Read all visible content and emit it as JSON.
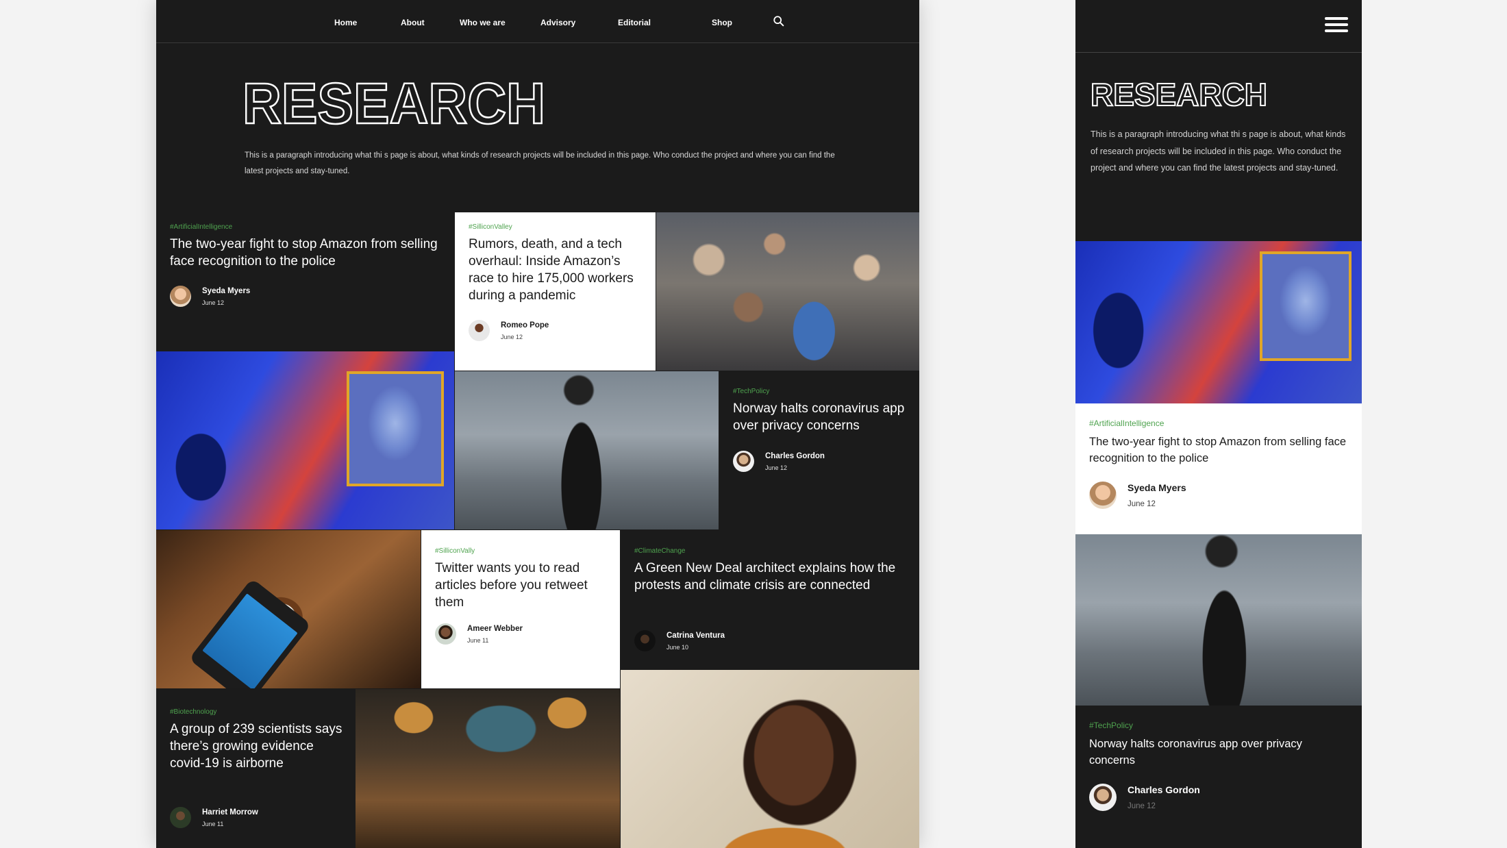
{
  "nav": {
    "items": [
      "Home",
      "About",
      "Who we are",
      "Advisory",
      "Editorial",
      "Shop"
    ],
    "search_icon": "search-icon"
  },
  "hero": {
    "title": "RESEARCH",
    "paragraph": "This is a paragraph introducing what thi s page is about, what kinds of research projects will be included in this page. Who conduct the project and where you can find the latest projects and stay-tuned."
  },
  "articles": [
    {
      "tag": "#ArtificialIntelligence",
      "title": "The two-year fight to stop Amazon from selling face recognition to the police",
      "author": "Syeda Myers",
      "date": "June 12"
    },
    {
      "tag": "#SilliconValley",
      "title": "Rumors, death, and a tech overhaul: Inside Amazon’s race to hire 175,000 workers during a pandemic",
      "author": "Romeo Pope",
      "date": "June 12"
    },
    {
      "tag": "#TechPolicy",
      "title": "Norway halts coronavirus app over privacy concerns",
      "author": "Charles Gordon",
      "date": "June 12"
    },
    {
      "tag": "#SilliconVally",
      "title": "Twitter wants you to read articles before you retweet them",
      "author": "Ameer Webber",
      "date": "June 11"
    },
    {
      "tag": "#ClimateChange",
      "title": "A Green New Deal architect explains how the protests and climate crisis are connected",
      "author": "Catrina Ventura",
      "date": "June 10"
    },
    {
      "tag": "#Biotechnology",
      "title": "A group of 239 scientists says there’s growing evidence covid-19 is airborne",
      "author": "Harriet Morrow",
      "date": "June 11"
    }
  ],
  "mobile": {
    "menu_icon": "hamburger-menu-icon",
    "title": "RESEARCH",
    "paragraph": "This is a paragraph introducing what thi s page is about, what kinds of research projects will be included in this page. Who conduct the project and where you can find the latest projects and stay-tuned.",
    "articles": [
      {
        "tag": "#ArtificialIntelligence",
        "title": "The two-year fight to stop Amazon from selling face recognition to the police",
        "author": "Syeda Myers",
        "date": "June 12"
      },
      {
        "tag": "#TechPolicy",
        "title": "Norway halts coronavirus app over privacy concerns",
        "author": "Charles Gordon",
        "date": "June 12"
      }
    ]
  },
  "colors": {
    "background": "#1b1b1b",
    "tag_green": "#4fa34f",
    "frame_yellow": "#e0a628",
    "page_bg": "#f3f3f3"
  }
}
